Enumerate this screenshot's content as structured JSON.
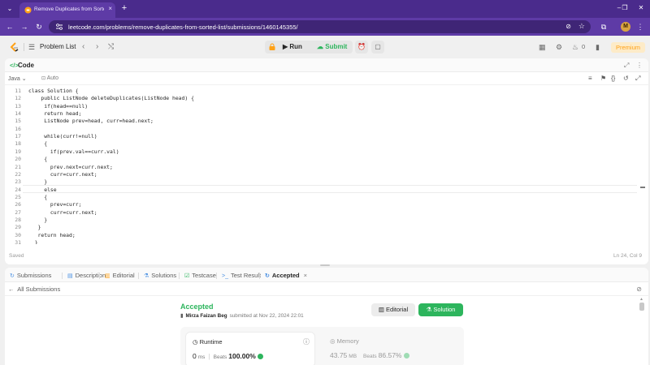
{
  "browser": {
    "tab_title": "Remove Duplicates from Sorted List - LeetCode",
    "tab_close": "×",
    "new_tab": "+",
    "menu_icon": "chevron-down-icon",
    "win_min": "–",
    "win_max": "❐",
    "win_close": "✕",
    "back": "←",
    "forward": "→",
    "reload": "↻",
    "url": "leetcode.com/problems/remove-duplicates-from-sorted-list/submissions/1460145355/",
    "eye_off": "⊘",
    "star": "☆",
    "extensions": "⧉",
    "downloads": "⤓",
    "profile_initial": "M",
    "kebab": "⋮"
  },
  "nav": {
    "problem_list_icon": "☰",
    "problem_list": "Problem List",
    "prev": "‹",
    "next": "›",
    "shuffle": "⤭",
    "run": "Run",
    "run_icon": "▶",
    "submit": "Submit",
    "submit_icon": "☁",
    "alarm": "⏰",
    "note": "▢",
    "layout": "▦",
    "settings": "⚙",
    "streak_icon": "♨",
    "streak_count": "0",
    "phone": "▮",
    "premium": "Premium"
  },
  "editor": {
    "icon": "</>",
    "title": "Code",
    "expand": "⤢",
    "more": "⋮",
    "language": "Java",
    "language_caret": "⌄",
    "mode_icon": "🔒",
    "mode": "Auto",
    "tool_format": "≡",
    "tool_bookmark": "⚑",
    "tool_braces": "{}",
    "tool_undo": "↺",
    "tool_fullscreen": "⤢",
    "lines": [
      {
        "num": "11",
        "text": "class Solution {"
      },
      {
        "num": "12",
        "text": "    public ListNode deleteDuplicates(ListNode head) {"
      },
      {
        "num": "13",
        "text": "     if(head==null)"
      },
      {
        "num": "14",
        "text": "     return head;"
      },
      {
        "num": "15",
        "text": "     ListNode prev=head, curr=head.next;"
      },
      {
        "num": "16",
        "text": ""
      },
      {
        "num": "17",
        "text": "     while(curr!=null)"
      },
      {
        "num": "18",
        "text": "     {"
      },
      {
        "num": "19",
        "text": "       if(prev.val==curr.val)"
      },
      {
        "num": "20",
        "text": "     {"
      },
      {
        "num": "21",
        "text": "       prev.next=curr.next;"
      },
      {
        "num": "22",
        "text": "       curr=curr.next;"
      },
      {
        "num": "23",
        "text": "     }"
      },
      {
        "num": "24",
        "text": "     else"
      },
      {
        "num": "25",
        "text": "     {"
      },
      {
        "num": "26",
        "text": "       prev=curr;"
      },
      {
        "num": "27",
        "text": "       curr=curr.next;"
      },
      {
        "num": "28",
        "text": "     }"
      },
      {
        "num": "29",
        "text": "   }"
      },
      {
        "num": "30",
        "text": "   return head;"
      },
      {
        "num": "31",
        "text": "  }"
      }
    ],
    "saved": "Saved",
    "cursor": "Ln 24, Col 9"
  },
  "bottom": {
    "tabs": [
      {
        "icon": "↻",
        "label": "Submissions"
      },
      {
        "icon": "▤",
        "label": "Description"
      },
      {
        "icon": "▥",
        "label": "Editorial"
      },
      {
        "icon": "⚗",
        "label": "Solutions"
      },
      {
        "icon": "☑",
        "label": "Testcase"
      },
      {
        "icon": ">_",
        "label": "Test Result"
      },
      {
        "icon": "↻",
        "label": "Accepted"
      }
    ],
    "tab_close": "×",
    "back_icon": "←",
    "all_submissions": "All Submissions",
    "link_icon": "🔗",
    "status": "Accepted",
    "user_icon": "▮",
    "username": "Mirza Faizan Beg",
    "submitted": "submitted at Nov 22, 2024 22:01",
    "editorial_btn": "Editorial",
    "editorial_icon": "▥",
    "solution_btn": "Solution",
    "solution_icon": "⚗",
    "runtime": {
      "icon": "◷",
      "title": "Runtime",
      "info": "ⓘ",
      "value": "0",
      "unit": "ms",
      "sep": "|",
      "beats_label": "Beats",
      "beats": "100.00%"
    },
    "memory": {
      "icon": "◎",
      "title": "Memory",
      "value": "43.75",
      "unit": "MB",
      "beats_label": "Beats",
      "beats": "86.57%"
    }
  },
  "colors": {
    "browser_frame": "#4a2b8c",
    "accent_green": "#2db55d",
    "premium_orange": "#ffa116"
  }
}
